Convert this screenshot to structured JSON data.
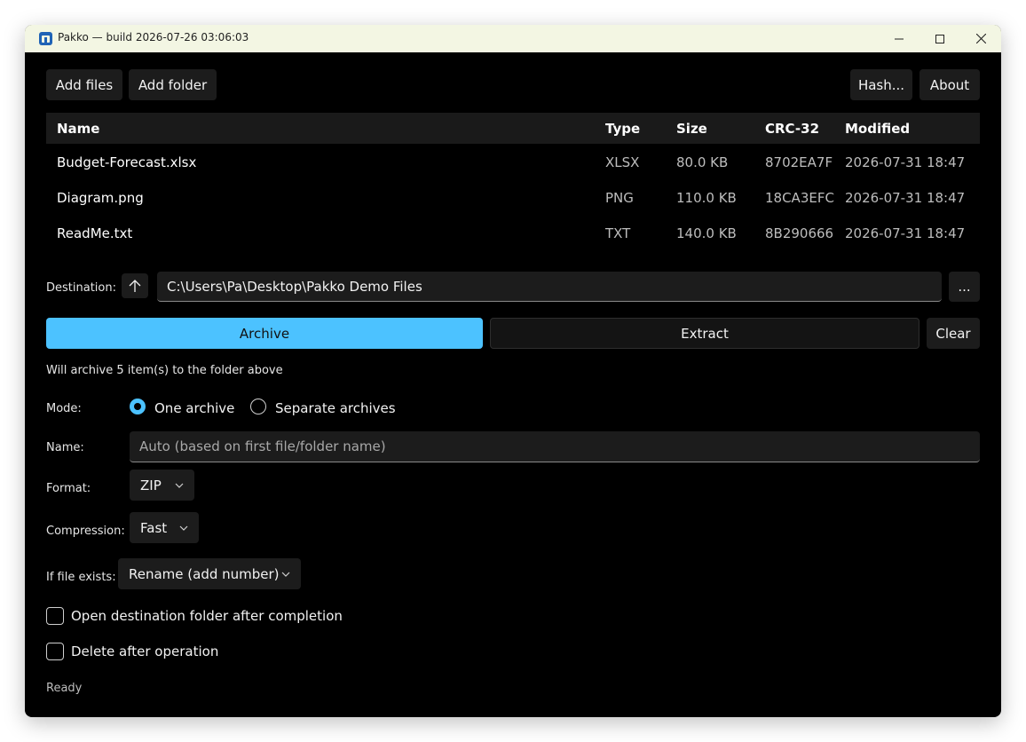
{
  "window": {
    "title": "Pakko — build 2026-07-26 03:06:03"
  },
  "toolbar": {
    "add_files": "Add files",
    "add_folder": "Add folder",
    "hash": "Hash...",
    "about": "About"
  },
  "table": {
    "headers": {
      "name": "Name",
      "type": "Type",
      "size": "Size",
      "crc": "CRC-32",
      "modified": "Modified"
    },
    "rows": [
      {
        "name": "Budget-Forecast.xlsx",
        "type": "XLSX",
        "size": "80.0 KB",
        "crc": "8702EA7F",
        "modified": "2026-07-31 18:47"
      },
      {
        "name": "Diagram.png",
        "type": "PNG",
        "size": "110.0 KB",
        "crc": "18CA3EFC",
        "modified": "2026-07-31 18:47"
      },
      {
        "name": "ReadMe.txt",
        "type": "TXT",
        "size": "140.0 KB",
        "crc": "8B290666",
        "modified": "2026-07-31 18:47"
      }
    ]
  },
  "destination": {
    "label": "Destination:",
    "path": "C:\\Users\\Pa\\Desktop\\Pakko Demo Files",
    "browse": "..."
  },
  "actions": {
    "archive": "Archive",
    "extract": "Extract",
    "clear": "Clear"
  },
  "status_info": "Will archive 5 item(s) to the folder above",
  "mode": {
    "label": "Mode:",
    "options": [
      "One archive",
      "Separate archives"
    ],
    "selected": "One archive"
  },
  "name_field": {
    "label": "Name:",
    "placeholder": "Auto (based on first file/folder name)"
  },
  "format": {
    "label": "Format:",
    "value": "ZIP"
  },
  "compression": {
    "label": "Compression:",
    "value": "Fast"
  },
  "if_exists": {
    "label": "If file exists:",
    "value": "Rename (add number)"
  },
  "options": {
    "open_dest": "Open destination folder after completion",
    "delete_after": "Delete after operation"
  },
  "status": "Ready",
  "colors": {
    "accent": "#4cc2ff",
    "background": "#000000",
    "titlebar": "#f3f6e3"
  }
}
